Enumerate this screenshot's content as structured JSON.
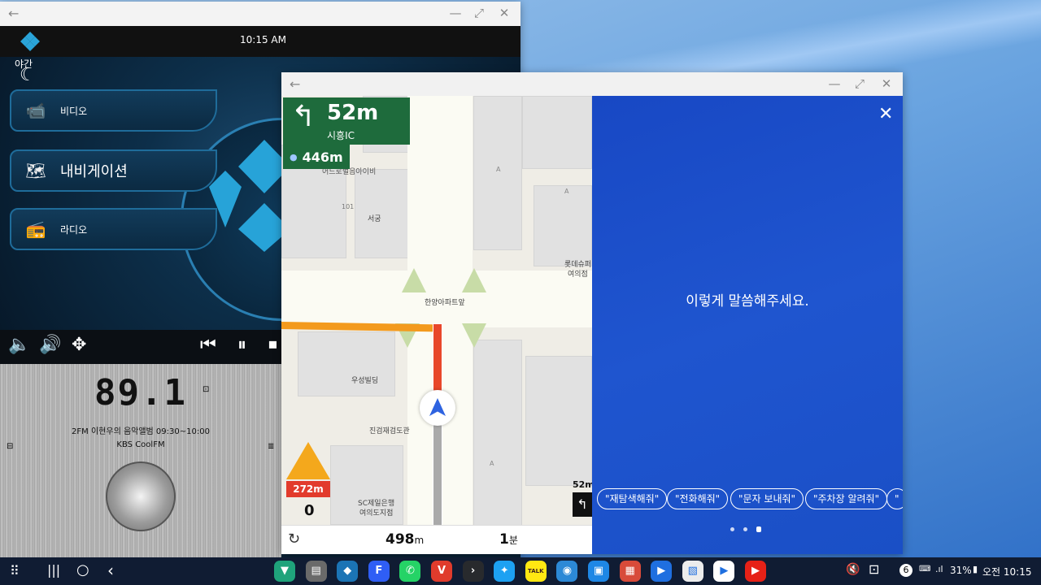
{
  "kodi": {
    "time": "10:15 AM",
    "weather_label": "야간",
    "menu": [
      {
        "label": "비디오"
      },
      {
        "label": "내비게이션"
      },
      {
        "label": "라디오"
      }
    ],
    "radio": {
      "frequency": "89.1",
      "program": "2FM 이현우의 음악앨범 09:30~10:00",
      "station": "KBS CoolFM"
    }
  },
  "nav": {
    "turn_distance": "52m",
    "turn_road": "시흥IC",
    "next_distance": "446m",
    "map_labels": {
      "top_label": "어드로벌음아이비",
      "label_101": "101",
      "seogung": "서궁",
      "lotte": "롯데슈퍼",
      "lotte2": "여의점",
      "apt": "한양아파트앞",
      "woosung": "우성빌딩",
      "jingun": "진검재검도관",
      "sc": "SC제일은행",
      "sc2": "여의도지점",
      "a1": "A",
      "a2": "A",
      "a3": "A"
    },
    "camera_distance": "272m",
    "speed": "0",
    "mini_turn_distance": "52m",
    "remaining_distance": "498",
    "remaining_distance_unit": "m",
    "remaining_time": "1",
    "remaining_time_unit": "분",
    "voice_prompt": "이렇게 말씀해주세요.",
    "voice_chips": [
      {
        "label": "\"재탐색해줘\""
      },
      {
        "label": "\"전화해줘\""
      },
      {
        "label": "\"문자 보내줘\""
      },
      {
        "label": "\"주차장 알려줘\""
      },
      {
        "label": "\""
      }
    ]
  },
  "taskbar": {
    "apps": [
      {
        "name": "navi",
        "color": "#1fa37b",
        "glyph": "▼"
      },
      {
        "name": "radio",
        "color": "#6a6a6a",
        "glyph": "▤"
      },
      {
        "name": "kodi",
        "color": "#1b74b5",
        "glyph": "◆"
      },
      {
        "name": "f-app",
        "color": "#2f5ef5",
        "glyph": "F"
      },
      {
        "name": "whatsapp",
        "color": "#25d366",
        "glyph": "✆"
      },
      {
        "name": "vivaldi",
        "color": "#e03b2c",
        "glyph": "V"
      },
      {
        "name": "plex",
        "color": "#282a2d",
        "glyph": "›"
      },
      {
        "name": "bird",
        "color": "#1da1f2",
        "glyph": "✦"
      },
      {
        "name": "kakaotalk",
        "color": "#ffe812",
        "glyph": "TALK"
      },
      {
        "name": "globe",
        "color": "#2c89d6",
        "glyph": "◉"
      },
      {
        "name": "vmx",
        "color": "#1e87e5",
        "glyph": "▣"
      },
      {
        "name": "store",
        "color": "#d84b3a",
        "glyph": "▦"
      },
      {
        "name": "play-video",
        "color": "#1f6fe0",
        "glyph": "▶"
      },
      {
        "name": "gallery",
        "color": "#ececec",
        "glyph": "▧"
      },
      {
        "name": "play-store",
        "color": "#ffffff",
        "glyph": "▶"
      },
      {
        "name": "youtube-music",
        "color": "#e62117",
        "glyph": "▶"
      }
    ],
    "status": {
      "notif_count": "6",
      "battery": "31%",
      "time": "오전 10:15"
    }
  }
}
